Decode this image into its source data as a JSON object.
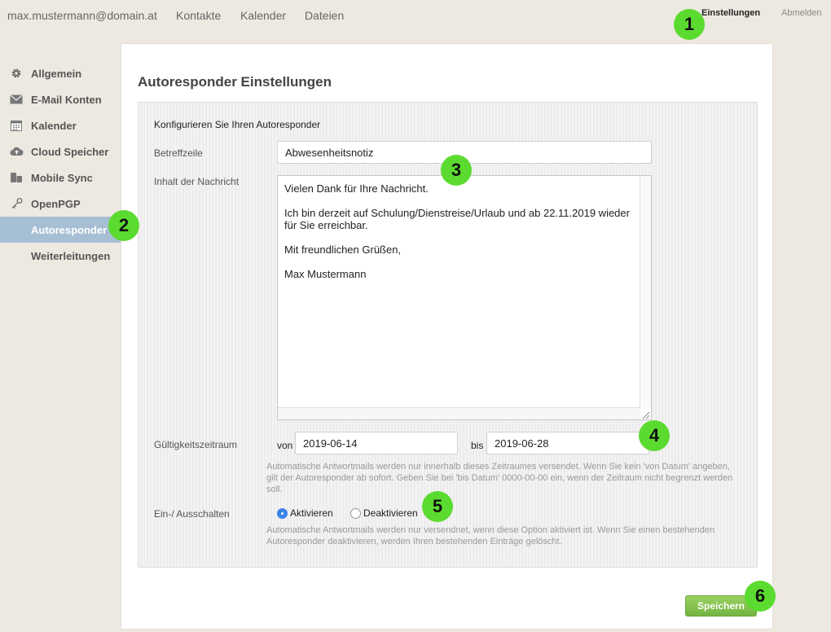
{
  "topbar": {
    "email": "max.mustermann@domain.at",
    "nav": [
      "Kontakte",
      "Kalender",
      "Dateien"
    ],
    "settings": "Einstellungen",
    "logout": "Abmelden"
  },
  "sidebar": {
    "items": [
      {
        "label": "Allgemein",
        "icon": "gear-icon"
      },
      {
        "label": "E-Mail Konten",
        "icon": "envelope-icon"
      },
      {
        "label": "Kalender",
        "icon": "calendar-icon"
      },
      {
        "label": "Cloud Speicher",
        "icon": "cloud-upload-icon"
      },
      {
        "label": "Mobile Sync",
        "icon": "mobile-sync-icon"
      },
      {
        "label": "OpenPGP",
        "icon": "key-icon"
      },
      {
        "label": "Autoresponder",
        "active": true
      },
      {
        "label": "Weiterleitungen"
      }
    ]
  },
  "page": {
    "title": "Autoresponder Einstellungen",
    "intro": "Konfigurieren Sie Ihren Autoresponder",
    "subject": {
      "label": "Betreffzeile",
      "value": "Abwesenheitsnotiz"
    },
    "message": {
      "label": "Inhalt der Nachricht",
      "lines": [
        "Vielen Dank für Ihre Nachricht.",
        "Ich bin derzeit auf Schulung/Dienstreise/Urlaub und ab 22.11.2019 wieder für Sie erreichbar.",
        "Mit freundlichen Grüßen,",
        "Max Mustermann"
      ]
    },
    "validity": {
      "label": "Gültigkeitszeitraum",
      "from_label": "von",
      "from_value": "2019-06-14",
      "to_label": "bis",
      "to_value": "2019-06-28",
      "help": "Automatische Antwortmails werden nur innerhalb dieses Zeitraumes versendet. Wenn Sie kein 'von Datum' angeben, gilt der Autoresponder ab sofort. Geben Sie bei 'bis Datum' 0000-00-00 ein, wenn der Zeitraum nicht begrenzt werden soll."
    },
    "toggle": {
      "label": "Ein-/ Ausschalten",
      "on_label": "Aktivieren",
      "off_label": "Deaktivieren",
      "selected": "Aktivieren",
      "help": "Automatische Antwortmails werden nur versendnet, wenn diese Option aktiviert ist. Wenn Sie einen bestehenden Autoresponder deaktivieren, werden Ihren bestehenden Einträge gelöscht."
    },
    "save_label": "Speichern"
  },
  "callouts": [
    "1",
    "2",
    "3",
    "4",
    "5",
    "6"
  ],
  "colors": {
    "accent_green": "#5bdb2f",
    "save_button": "#7fbf48",
    "sidebar_active": "#a7bfd4",
    "radio_selected": "#3a84e8"
  }
}
